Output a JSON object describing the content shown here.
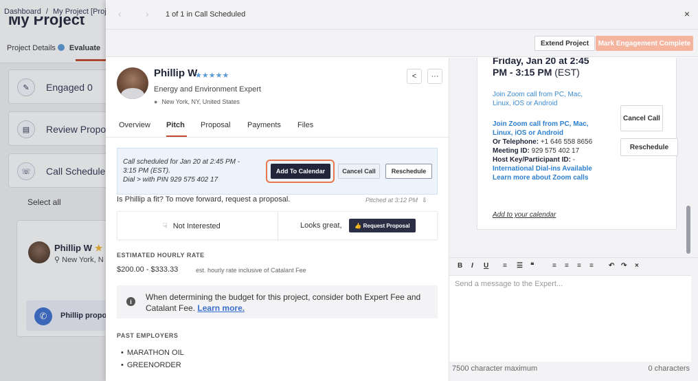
{
  "background": {
    "breadcrumb": [
      "Dashboard",
      "/",
      "My Project [Proj"
    ],
    "title": "My Project",
    "tab_details": "Project Details",
    "tab_evaluate": "Evaluate",
    "cards": [
      "Engaged 0",
      "Review Propos",
      "Call Scheduled"
    ],
    "select_all": "Select all",
    "expert_name": "Phillip W",
    "expert_location": "New York, N",
    "propose_label": "Phillip propo"
  },
  "modal": {
    "counter": "1 of 1 in Call Scheduled",
    "close": "×",
    "extend_label": "Extend Project",
    "complete_label": "Mark Engagement Complete"
  },
  "expert": {
    "name": "Phillip W.",
    "stars": "★★★★★",
    "role": "Energy and Environment Expert",
    "location": "New York, NY, United States"
  },
  "tabs": [
    "Overview",
    "Pitch",
    "Proposal",
    "Payments",
    "Files"
  ],
  "schedule": {
    "text_line1": "Call scheduled for Jan 20 at 2:45 PM -",
    "text_line2": "3:15 PM (EST).",
    "text_line3": "Dial > with PIN 929 575 402 17",
    "add_calendar": "Add To Calendar",
    "cancel": "Cancel Call",
    "reschedule": "Reschedule"
  },
  "fit": {
    "question": "Is Phillip a fit? To move forward, request a proposal.",
    "pitched": "Pitched at 3:12 PM",
    "not_interested": "Not Interested",
    "looks_great": "Looks great,",
    "request_proposal": "Request Proposal"
  },
  "rate": {
    "label": "ESTIMATED HOURLY RATE",
    "value": "$200.00 - $333.33",
    "note": "est. hourly rate inclusive of Catalant Fee"
  },
  "info": {
    "text": "When determining the budget for this project, consider both Expert Fee and Catalant Fee.",
    "link": "Learn more."
  },
  "employers": {
    "label": "PAST EMPLOYERS",
    "items": [
      "MARATHON OIL",
      "GREENORDER"
    ]
  },
  "calendar": {
    "when": "Friday, Jan 20 at 2:45 PM - 3:15 PM",
    "tz": "(EST)",
    "zoom_join_a": "Join Zoom call from PC, Mac, Linux, iOS or Android",
    "zoom_join_b": "Join Zoom call from PC, Mac, Linux, iOS or Android",
    "telephone_label": "Or Telephone:",
    "telephone_value": "+1 646 558 8656",
    "meeting_label": "Meeting ID:",
    "meeting_value": "929 575 402 17",
    "host_label": "Host Key/Participant ID:",
    "host_value": "-",
    "intl": "International Dial-ins Available",
    "learn_zoom": "Learn more about Zoom calls",
    "add_to_calendar": "Add to your calendar",
    "cancel_call": "Cancel Call",
    "reschedule": "Reschedule"
  },
  "editor": {
    "toolbar": [
      "B",
      "I",
      "U",
      "≡",
      "☰",
      "❝",
      "≡",
      "≡",
      "≡",
      "≡",
      "↶",
      "↷",
      "×"
    ],
    "placeholder": "Send a message to the Expert...",
    "char_max": "7500 character maximum",
    "char_count": "0 characters"
  },
  "colors": {
    "accent": "#c04a2f",
    "highlight": "#e8774e",
    "link": "#3b6ed1",
    "dark_button": "#23263b",
    "complete_button": "#f4b49e"
  }
}
